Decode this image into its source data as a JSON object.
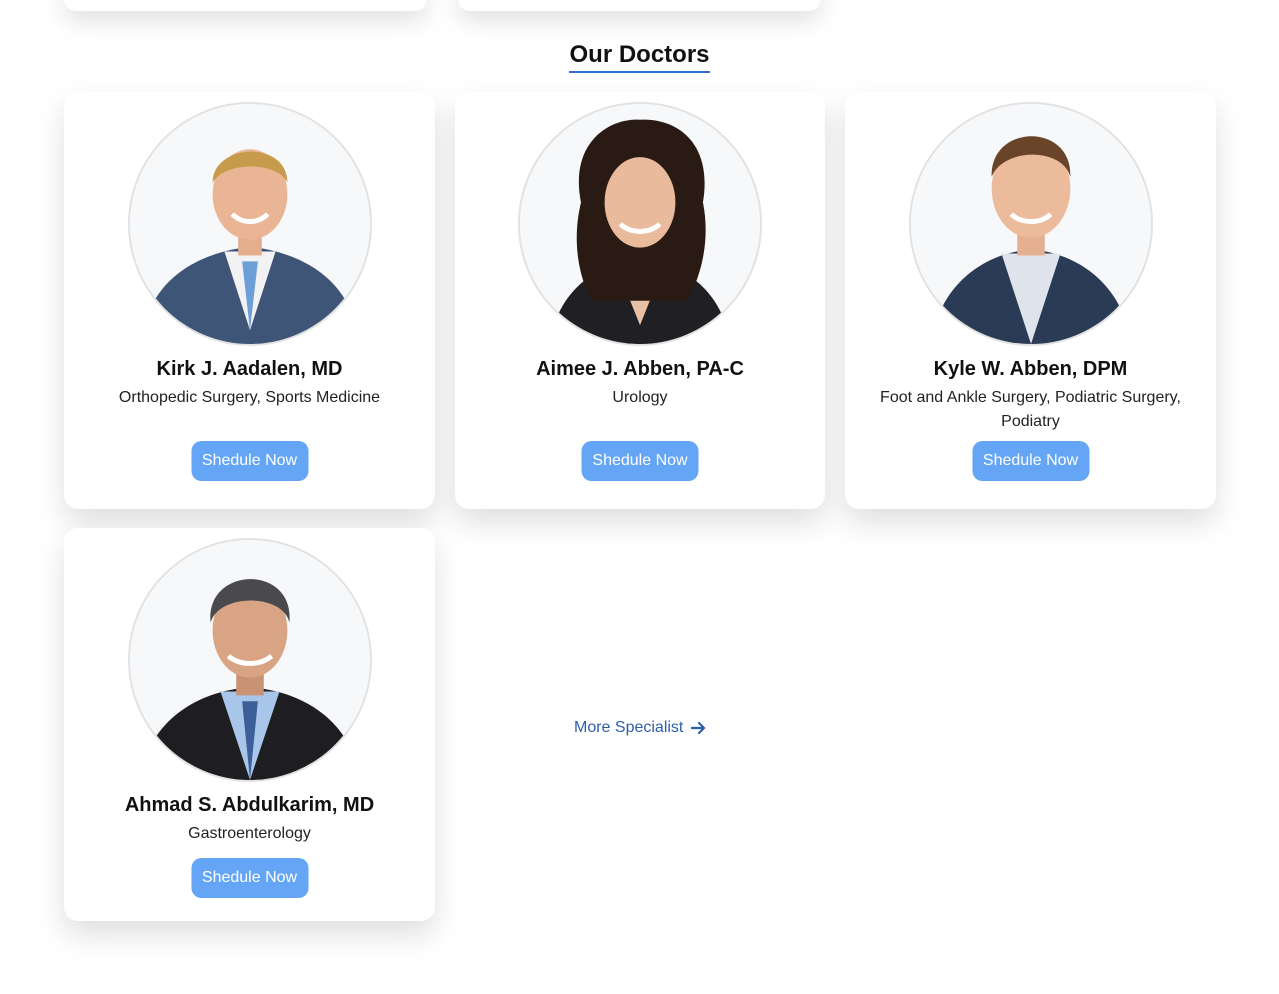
{
  "section": {
    "title": "Our Doctors"
  },
  "doctors": [
    {
      "name": "Kirk J. Aadalen, MD",
      "specialty": "Orthopedic Surgery, Sports Medicine",
      "button": "Shedule Now"
    },
    {
      "name": "Aimee J. Abben, PA-C",
      "specialty": "Urology",
      "button": "Shedule Now"
    },
    {
      "name": "Kyle W. Abben, DPM",
      "specialty": "Foot and Ankle Surgery, Podiatric Surgery, Podiatry",
      "button": "Shedule Now"
    },
    {
      "name": "Ahmad S. Abdulkarim, MD",
      "specialty": "Gastroenterology",
      "button": "Shedule Now"
    }
  ],
  "more_link": {
    "label": "More Specialist",
    "icon": "arrow-right-icon"
  },
  "colors": {
    "accent": "#64a6f5",
    "link": "#2e5ea8",
    "underline": "#2e6fc9"
  }
}
